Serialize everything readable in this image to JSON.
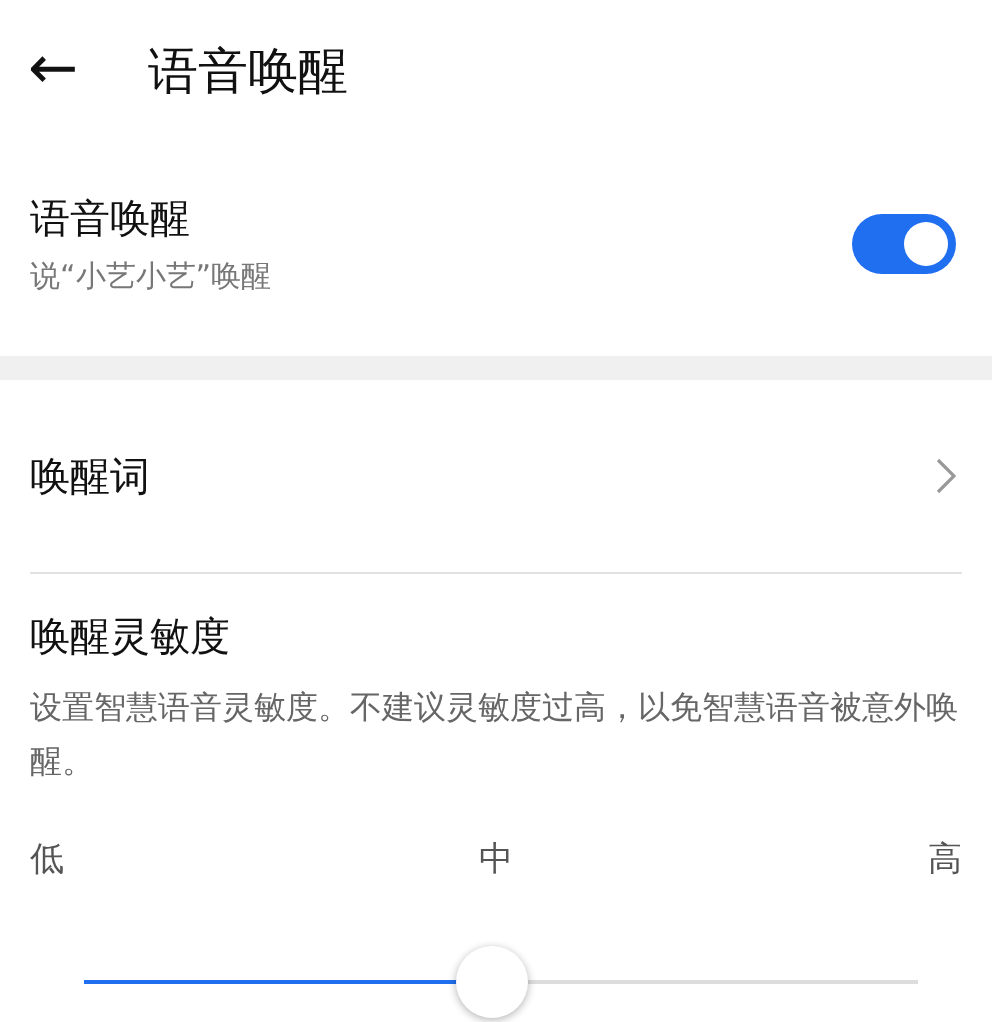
{
  "header": {
    "back_icon": "←",
    "title": "语音唤醒"
  },
  "voice_wake": {
    "title": "语音唤醒",
    "subtitle": "说“小艺小艺”唤醒",
    "on": true
  },
  "wake_word": {
    "title": "唤醒词"
  },
  "sensitivity": {
    "title": "唤醒灵敏度",
    "description": "设置智慧语音灵敏度。不建议灵敏度过高，以免智慧语音被意外唤醒。",
    "labels": [
      "低",
      "中",
      "高"
    ],
    "level": 0.49
  }
}
